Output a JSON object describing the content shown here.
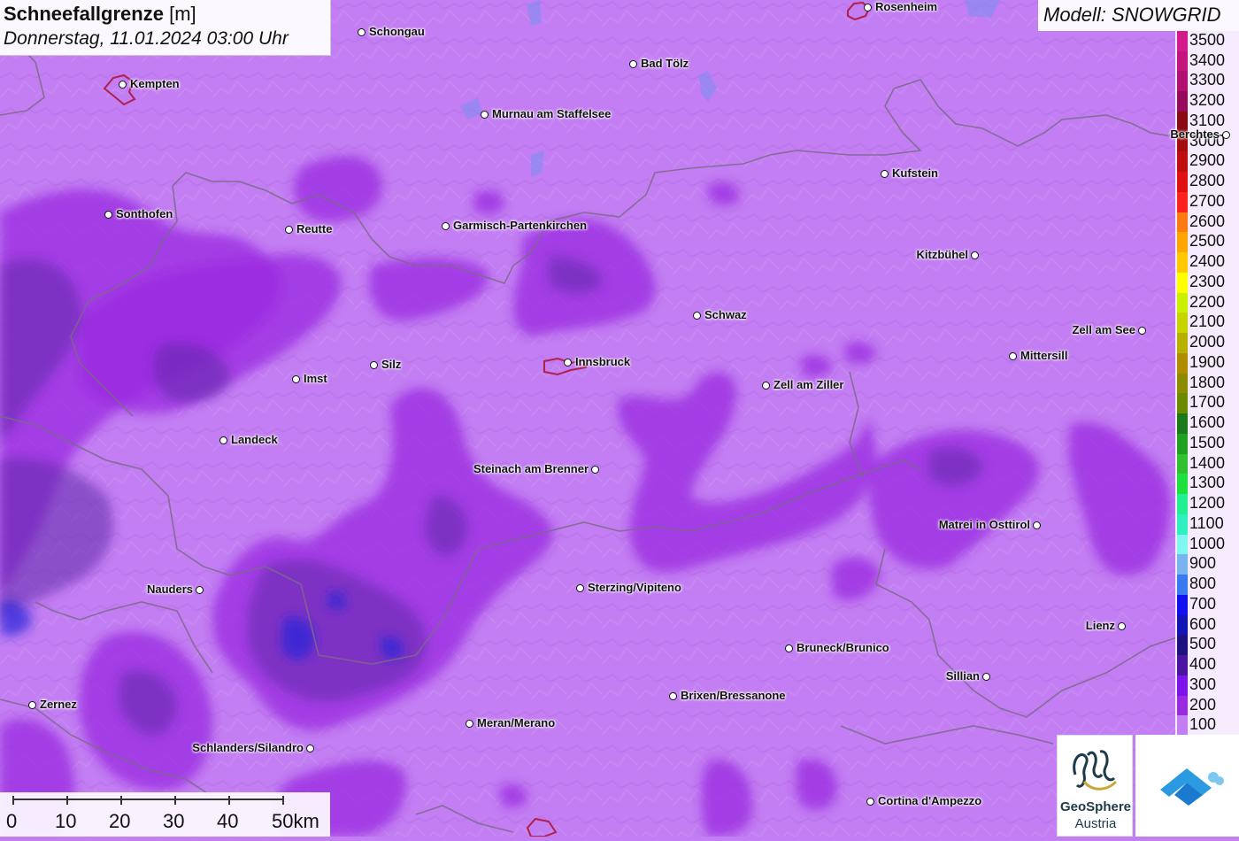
{
  "header": {
    "title_bold": "Schneefallgrenze",
    "title_unit": "[m]",
    "subtitle": "Donnerstag, 11.01.2024 03:00 Uhr",
    "model": "Modell: SNOWGRID"
  },
  "legend": {
    "entries": [
      {
        "label": "3500",
        "color": "#d21a8c"
      },
      {
        "label": "3400",
        "color": "#c4157c"
      },
      {
        "label": "3300",
        "color": "#b01070"
      },
      {
        "label": "3200",
        "color": "#960a5c"
      },
      {
        "label": "3100",
        "color": "#8a0a14"
      },
      {
        "label": "3000",
        "color": "#a30d0d"
      },
      {
        "label": "2900",
        "color": "#c00e0e"
      },
      {
        "label": "2800",
        "color": "#e01010"
      },
      {
        "label": "2700",
        "color": "#ff2020"
      },
      {
        "label": "2600",
        "color": "#ff7a10"
      },
      {
        "label": "2500",
        "color": "#ffa500"
      },
      {
        "label": "2400",
        "color": "#ffc800"
      },
      {
        "label": "2300",
        "color": "#ffff00"
      },
      {
        "label": "2200",
        "color": "#c8f000"
      },
      {
        "label": "2100",
        "color": "#c8d400"
      },
      {
        "label": "2000",
        "color": "#b8b000"
      },
      {
        "label": "1900",
        "color": "#b08c00"
      },
      {
        "label": "1800",
        "color": "#8c8c00"
      },
      {
        "label": "1700",
        "color": "#6a8a00"
      },
      {
        "label": "1600",
        "color": "#1a7a1a"
      },
      {
        "label": "1500",
        "color": "#20a020"
      },
      {
        "label": "1400",
        "color": "#30c030"
      },
      {
        "label": "1300",
        "color": "#20e040"
      },
      {
        "label": "1200",
        "color": "#20f090"
      },
      {
        "label": "1100",
        "color": "#30f0c0"
      },
      {
        "label": "1000",
        "color": "#80f8f0"
      },
      {
        "label": "900",
        "color": "#7ab4f0"
      },
      {
        "label": "800",
        "color": "#3a7af0"
      },
      {
        "label": "700",
        "color": "#1010f0"
      },
      {
        "label": "600",
        "color": "#1414b4"
      },
      {
        "label": "500",
        "color": "#1e1280"
      },
      {
        "label": "400",
        "color": "#4a14a0"
      },
      {
        "label": "300",
        "color": "#7a14e8"
      },
      {
        "label": "200",
        "color": "#9a2ae0"
      },
      {
        "label": "100",
        "color": "#c27ef2"
      }
    ]
  },
  "cities": [
    {
      "name": "Rosenheim"
    },
    {
      "name": "Schongau"
    },
    {
      "name": "Bad Tölz"
    },
    {
      "name": "Kempten"
    },
    {
      "name": "Murnau am Staffelsee"
    },
    {
      "name": "Berchtes"
    },
    {
      "name": "Kufstein"
    },
    {
      "name": "Sonthofen"
    },
    {
      "name": "Reutte"
    },
    {
      "name": "Garmisch-Partenkirchen"
    },
    {
      "name": "Kitzbühel"
    },
    {
      "name": "Schwaz"
    },
    {
      "name": "Zell am See"
    },
    {
      "name": "Mittersill"
    },
    {
      "name": "Innsbruck"
    },
    {
      "name": "Silz"
    },
    {
      "name": "Imst"
    },
    {
      "name": "Zell am Ziller"
    },
    {
      "name": "Landeck"
    },
    {
      "name": "Steinach am Brenner"
    },
    {
      "name": "Matrei in Osttirol"
    },
    {
      "name": "Nauders"
    },
    {
      "name": "Sterzing/Vipiteno"
    },
    {
      "name": "Lienz"
    },
    {
      "name": "Bruneck/Brunico"
    },
    {
      "name": "Sillian"
    },
    {
      "name": "Brixen/Bressanone"
    },
    {
      "name": "Zernez"
    },
    {
      "name": "Meran/Merano"
    },
    {
      "name": "Schlanders/Silandro"
    },
    {
      "name": "Cortina d'Ampezzo"
    }
  ],
  "scale": {
    "labels": [
      "0",
      "10",
      "20",
      "30",
      "40",
      "50km"
    ]
  },
  "logos": {
    "geosphere_name": "GeoSphere",
    "geosphere_sub": "Austria"
  },
  "colors": {
    "base": "#c27ef2",
    "band_200": "#9a2ae0",
    "band_300": "#8a3ed8",
    "band_400": "#5e2aa8",
    "band_700": "#2424d8",
    "border": "#7a6a88",
    "city_outline": "#b0204a"
  }
}
